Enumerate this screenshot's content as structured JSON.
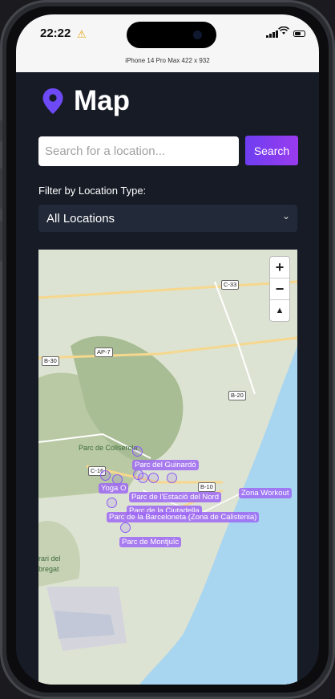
{
  "status_bar": {
    "time": "22:22",
    "device": "iPhone 14 Pro Max  422 x 932"
  },
  "header": {
    "title": "Map"
  },
  "search": {
    "placeholder": "Search for a location...",
    "button": "Search"
  },
  "filter": {
    "label": "Filter by Location Type:",
    "selected": "All Locations"
  },
  "map": {
    "zoom_in": "+",
    "zoom_out": "−",
    "reset": "▲",
    "roads": [
      "C-33",
      "AP-7",
      "B-30",
      "B-20",
      "C-16",
      "B-10"
    ],
    "places": [
      "Parc de Collserola",
      "rari del",
      "bregat"
    ],
    "locations": [
      "Parc del Guinardó",
      "Yoga O",
      "Parc de l'Estació del Nord",
      "Parc de la Barceloneta (Zona de Calistenia)",
      "Parc de Montjuïc",
      "Parc de la Ciutadella",
      "Zona Workout"
    ]
  }
}
